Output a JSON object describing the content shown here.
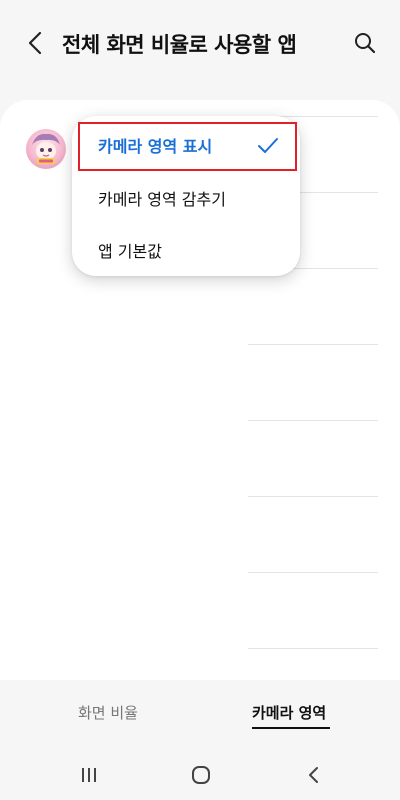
{
  "header": {
    "title": "전체 화면 비율로 사용할 앱",
    "back_icon": "chevron-left-icon",
    "search_icon": "search-icon"
  },
  "dropdown": {
    "items": [
      {
        "label": "카메라 영역 표시",
        "selected": true
      },
      {
        "label": "카메라 영역 감추기",
        "selected": false
      },
      {
        "label": "앱 기본값",
        "selected": false
      }
    ],
    "selected_color": "#1a6fd6",
    "highlight_color": "#e0202a"
  },
  "tabs": {
    "items": [
      {
        "label": "화면 비율",
        "active": false
      },
      {
        "label": "카메라 영역",
        "active": true
      }
    ]
  },
  "navbar": {
    "recents_icon": "recents-icon",
    "home_icon": "home-icon",
    "back_icon": "back-icon"
  }
}
